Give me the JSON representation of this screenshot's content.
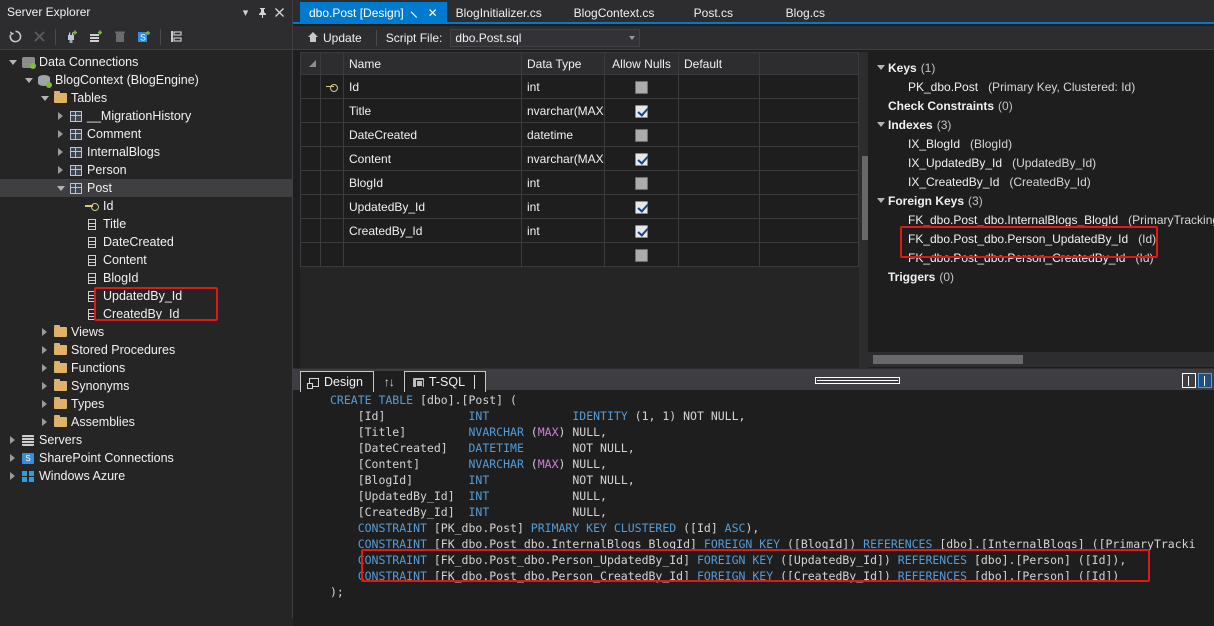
{
  "server_explorer": {
    "title": "Server Explorer",
    "header_buttons": [
      {
        "name": "dropdown-icon",
        "glyph": "▾"
      },
      {
        "name": "pin-icon",
        "glyph": "⚲"
      },
      {
        "name": "close-icon",
        "glyph": "✕"
      }
    ],
    "toolbar": [
      {
        "name": "refresh-icon",
        "label": "Refresh"
      },
      {
        "name": "stop-icon",
        "label": "Stop"
      },
      {
        "name": "connect-to-database-icon",
        "label": "Connect to Database"
      },
      {
        "name": "add-server-icon",
        "label": "Add Server"
      },
      {
        "name": "delete-icon",
        "label": "Delete"
      },
      {
        "name": "sharepoint-connection-icon",
        "label": "Add SharePoint Connection"
      },
      {
        "name": "properties-icon",
        "label": "Properties"
      }
    ],
    "tree": [
      {
        "label": "Data Connections",
        "depth": 0,
        "icon": "data-connections-icon",
        "expander": "down"
      },
      {
        "label": "BlogContext (BlogEngine)",
        "depth": 1,
        "icon": "database-icon",
        "expander": "down"
      },
      {
        "label": "Tables",
        "depth": 2,
        "icon": "folder-icon",
        "expander": "down"
      },
      {
        "label": "__MigrationHistory",
        "depth": 3,
        "icon": "table-icon",
        "expander": "right"
      },
      {
        "label": "Comment",
        "depth": 3,
        "icon": "table-icon",
        "expander": "right"
      },
      {
        "label": "InternalBlogs",
        "depth": 3,
        "icon": "table-icon",
        "expander": "right"
      },
      {
        "label": "Person",
        "depth": 3,
        "icon": "table-icon",
        "expander": "right"
      },
      {
        "label": "Post",
        "depth": 3,
        "icon": "table-icon",
        "expander": "down",
        "selected": true
      },
      {
        "label": "Id",
        "depth": 4,
        "icon": "primary-key-icon",
        "expander": "none"
      },
      {
        "label": "Title",
        "depth": 4,
        "icon": "column-icon",
        "expander": "none"
      },
      {
        "label": "DateCreated",
        "depth": 4,
        "icon": "column-icon",
        "expander": "none"
      },
      {
        "label": "Content",
        "depth": 4,
        "icon": "column-icon",
        "expander": "none"
      },
      {
        "label": "BlogId",
        "depth": 4,
        "icon": "column-icon",
        "expander": "none"
      },
      {
        "label": "UpdatedBy_Id",
        "depth": 4,
        "icon": "column-icon",
        "expander": "none",
        "highlighted": true
      },
      {
        "label": "CreatedBy_Id",
        "depth": 4,
        "icon": "column-icon",
        "expander": "none",
        "highlighted": true
      },
      {
        "label": "Views",
        "depth": 2,
        "icon": "folder-icon",
        "expander": "right"
      },
      {
        "label": "Stored Procedures",
        "depth": 2,
        "icon": "folder-icon",
        "expander": "right"
      },
      {
        "label": "Functions",
        "depth": 2,
        "icon": "folder-icon",
        "expander": "right"
      },
      {
        "label": "Synonyms",
        "depth": 2,
        "icon": "folder-icon",
        "expander": "right"
      },
      {
        "label": "Types",
        "depth": 2,
        "icon": "folder-icon",
        "expander": "right"
      },
      {
        "label": "Assemblies",
        "depth": 2,
        "icon": "folder-icon",
        "expander": "right"
      },
      {
        "label": "Servers",
        "depth": 0,
        "icon": "servers-icon",
        "expander": "right"
      },
      {
        "label": "SharePoint Connections",
        "depth": 0,
        "icon": "sharepoint-icon",
        "expander": "right"
      },
      {
        "label": "Windows Azure",
        "depth": 0,
        "icon": "azure-icon",
        "expander": "right"
      }
    ]
  },
  "tabs": [
    {
      "label": "dbo.Post [Design]",
      "active": true,
      "pin": "⚲",
      "close": "✕"
    },
    {
      "label": "BlogInitializer.cs",
      "active": false
    },
    {
      "label": "BlogContext.cs",
      "active": false
    },
    {
      "label": "Post.cs",
      "active": false
    },
    {
      "label": "Blog.cs",
      "active": false
    }
  ],
  "designer_toolbar": {
    "update_label": "Update",
    "script_file_label": "Script File:",
    "script_file_value": "dbo.Post.sql"
  },
  "grid": {
    "headers": [
      "Name",
      "Data Type",
      "Allow Nulls",
      "Default"
    ],
    "rows": [
      {
        "key": true,
        "name": "Id",
        "type": "int",
        "allow_nulls": false
      },
      {
        "key": false,
        "name": "Title",
        "type": "nvarchar(MAX)",
        "allow_nulls": true
      },
      {
        "key": false,
        "name": "DateCreated",
        "type": "datetime",
        "allow_nulls": false
      },
      {
        "key": false,
        "name": "Content",
        "type": "nvarchar(MAX)",
        "allow_nulls": true
      },
      {
        "key": false,
        "name": "BlogId",
        "type": "int",
        "allow_nulls": false
      },
      {
        "key": false,
        "name": "UpdatedBy_Id",
        "type": "int",
        "allow_nulls": true
      },
      {
        "key": false,
        "name": "CreatedBy_Id",
        "type": "int",
        "allow_nulls": true
      },
      {
        "key": false,
        "name": "",
        "type": "",
        "allow_nulls": false
      }
    ]
  },
  "properties_pane": {
    "sections": [
      {
        "title": "Keys",
        "count": "(1)",
        "expander": "down",
        "items": [
          {
            "name": "PK_dbo.Post",
            "detail": "(Primary Key, Clustered: Id)"
          }
        ]
      },
      {
        "title": "Check Constraints",
        "count": "(0)",
        "expander": "none",
        "items": []
      },
      {
        "title": "Indexes",
        "count": "(3)",
        "expander": "down",
        "items": [
          {
            "name": "IX_BlogId",
            "detail": "(BlogId)"
          },
          {
            "name": "IX_UpdatedBy_Id",
            "detail": "(UpdatedBy_Id)"
          },
          {
            "name": "IX_CreatedBy_Id",
            "detail": "(CreatedBy_Id)"
          }
        ]
      },
      {
        "title": "Foreign Keys",
        "count": "(3)",
        "expander": "down",
        "items": [
          {
            "name": "FK_dbo.Post_dbo.InternalBlogs_BlogId",
            "detail": "(PrimaryTracking"
          },
          {
            "name": "FK_dbo.Post_dbo.Person_UpdatedBy_Id",
            "detail": "(Id)",
            "highlighted": true
          },
          {
            "name": "FK_dbo.Post_dbo.Person_CreatedBy_Id",
            "detail": "(Id)",
            "highlighted": true
          }
        ]
      },
      {
        "title": "Triggers",
        "count": "(0)",
        "expander": "none",
        "items": []
      }
    ]
  },
  "editor_tabs": [
    {
      "label": "Design",
      "icon": "design-icon",
      "active": true
    },
    {
      "label": "",
      "icon": "swap-icon",
      "active": false
    },
    {
      "label": "T-SQL",
      "icon": "tsql-icon",
      "active": true
    }
  ],
  "sql": {
    "lines": [
      [
        [
          "CREATE TABLE",
          "k"
        ],
        [
          " [dbo].[Post] (",
          "pl"
        ]
      ],
      [
        [
          "    [Id]            ",
          "pl"
        ],
        [
          "INT",
          "k"
        ],
        [
          "            ",
          "pl"
        ],
        [
          "IDENTITY",
          "k"
        ],
        [
          " (1, 1) NOT NULL,",
          "pl"
        ]
      ],
      [
        [
          "    [Title]         ",
          "pl"
        ],
        [
          "NVARCHAR",
          "k"
        ],
        [
          " (",
          "pl"
        ],
        [
          "MAX",
          "mx"
        ],
        [
          ") NULL,",
          "pl"
        ]
      ],
      [
        [
          "    [DateCreated]   ",
          "pl"
        ],
        [
          "DATETIME",
          "k"
        ],
        [
          "       NOT NULL,",
          "pl"
        ]
      ],
      [
        [
          "    [Content]       ",
          "pl"
        ],
        [
          "NVARCHAR",
          "k"
        ],
        [
          " (",
          "pl"
        ],
        [
          "MAX",
          "mx"
        ],
        [
          ") NULL,",
          "pl"
        ]
      ],
      [
        [
          "    [BlogId]        ",
          "pl"
        ],
        [
          "INT",
          "k"
        ],
        [
          "            NOT NULL,",
          "pl"
        ]
      ],
      [
        [
          "    [UpdatedBy_Id]  ",
          "pl"
        ],
        [
          "INT",
          "k"
        ],
        [
          "            NULL,",
          "pl"
        ]
      ],
      [
        [
          "    [CreatedBy_Id]  ",
          "pl"
        ],
        [
          "INT",
          "k"
        ],
        [
          "            NULL,",
          "pl"
        ]
      ],
      [
        [
          "    CONSTRAINT",
          "k"
        ],
        [
          " [PK_dbo.Post] ",
          "pl"
        ],
        [
          "PRIMARY KEY CLUSTERED",
          "k"
        ],
        [
          " ([Id] ",
          "pl"
        ],
        [
          "ASC",
          "k"
        ],
        [
          "),",
          "pl"
        ]
      ],
      [
        [
          "    CONSTRAINT",
          "k"
        ],
        [
          " [FK_dbo.Post_dbo.InternalBlogs_BlogId] ",
          "pl"
        ],
        [
          "FOREIGN KEY",
          "k"
        ],
        [
          " ([BlogId]) ",
          "pl"
        ],
        [
          "REFERENCES",
          "k"
        ],
        [
          " [dbo].[InternalBlogs] ([PrimaryTracki",
          "pl"
        ]
      ],
      [
        [
          "    CONSTRAINT",
          "k"
        ],
        [
          " [FK_dbo.Post_dbo.Person_UpdatedBy_Id] ",
          "pl"
        ],
        [
          "FOREIGN KEY",
          "k"
        ],
        [
          " ([UpdatedBy_Id]) ",
          "pl"
        ],
        [
          "REFERENCES",
          "k"
        ],
        [
          " [dbo].[Person] ([Id]),",
          "pl"
        ]
      ],
      [
        [
          "    CONSTRAINT",
          "k"
        ],
        [
          " [FK_dbo.Post_dbo.Person_CreatedBy_Id] ",
          "pl"
        ],
        [
          "FOREIGN KEY",
          "k"
        ],
        [
          " ([CreatedBy_Id]) ",
          "pl"
        ],
        [
          "REFERENCES",
          "k"
        ],
        [
          " [dbo].[Person] ([Id])",
          "pl"
        ]
      ],
      [
        [
          ");",
          "pl"
        ]
      ]
    ]
  },
  "colors": {
    "accent": "#007acc",
    "highlight_box": "#e01818",
    "keyword": "#569cd6",
    "max_literal": "#cf7fd6",
    "background": "#1e1e1e",
    "panel": "#2d2d30"
  }
}
